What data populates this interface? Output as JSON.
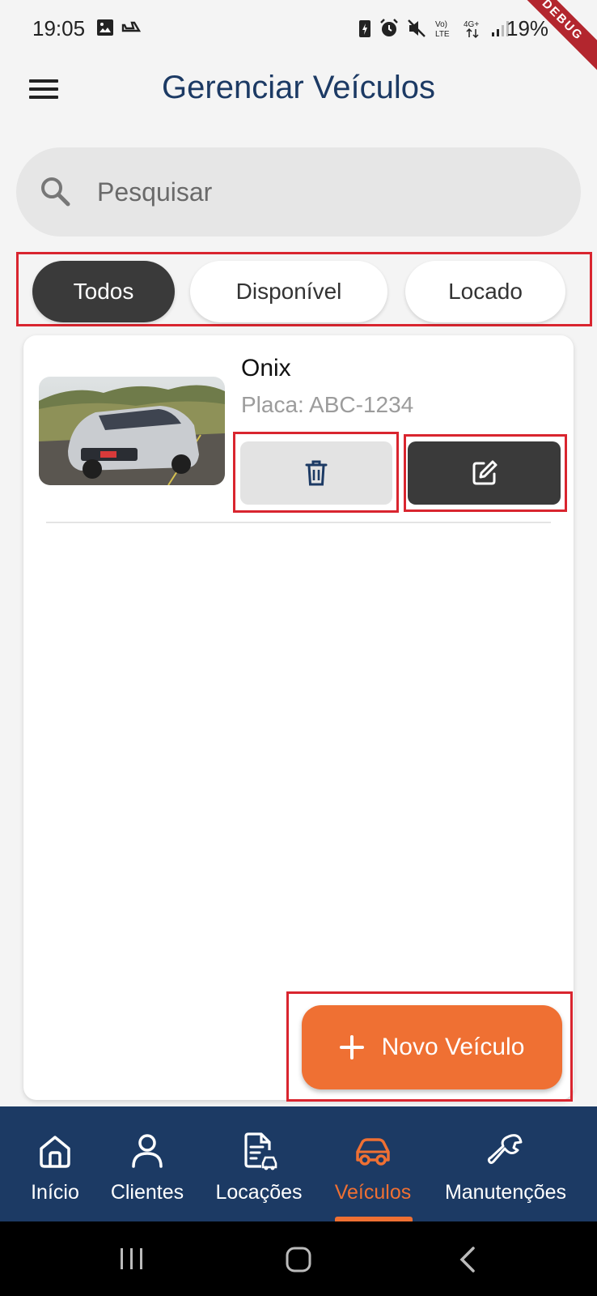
{
  "status_bar": {
    "time": "19:05",
    "battery": "19%",
    "debug_banner": "DEBUG"
  },
  "app_bar": {
    "title": "Gerenciar Veículos",
    "menu_icon": "hamburger-menu-icon"
  },
  "search": {
    "placeholder": "Pesquisar",
    "value": "",
    "icon": "search-icon"
  },
  "filters": [
    {
      "label": "Todos",
      "selected": true
    },
    {
      "label": "Disponível",
      "selected": false
    },
    {
      "label": "Locado",
      "selected": false
    }
  ],
  "vehicles": [
    {
      "name": "Onix",
      "plate": "Placa: ABC-1234",
      "delete_icon": "trash-icon",
      "edit_icon": "edit-icon"
    }
  ],
  "fab": {
    "label": "Novo Veículo",
    "icon": "plus-icon"
  },
  "bottom_nav": [
    {
      "label": "Início",
      "icon": "home-icon",
      "active": false
    },
    {
      "label": "Clientes",
      "icon": "user-icon",
      "active": false
    },
    {
      "label": "Locações",
      "icon": "document-car-icon",
      "active": false
    },
    {
      "label": "Veículos",
      "icon": "car-icon",
      "active": true
    },
    {
      "label": "Manutenções",
      "icon": "wrench-icon",
      "active": false
    }
  ],
  "colors": {
    "primary": "#1c3a64",
    "accent": "#ef7033",
    "chip_selected": "#3a3a3a",
    "highlight": "#d9252f"
  }
}
